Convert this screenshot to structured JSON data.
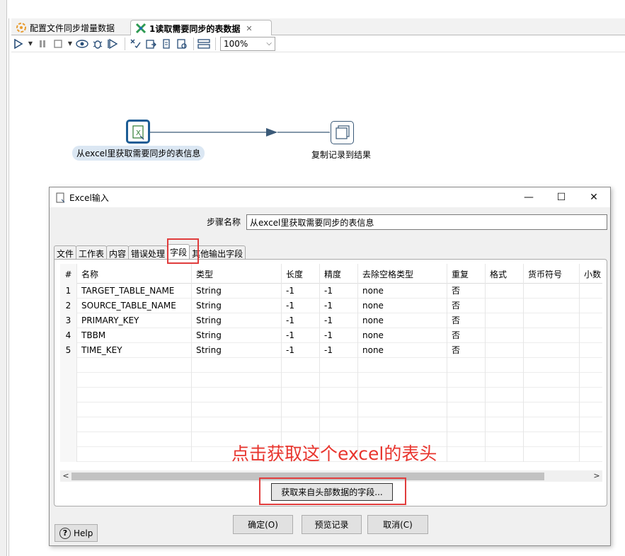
{
  "editor_tabs": [
    {
      "label": "配置文件同步增量数据",
      "icon": "transformation-icon",
      "active": false
    },
    {
      "label": "1读取需要同步的表数据",
      "icon": "job-icon",
      "active": true
    }
  ],
  "toolbar": {
    "zoom": "100%",
    "icons": [
      "run-icon",
      "run-dropdown-icon",
      "pause-icon",
      "stop-icon",
      "stop-dropdown-icon",
      "preview-icon",
      "debug-icon",
      "replay-icon",
      "verify-icon",
      "impact-icon",
      "sql-icon",
      "explore-db-icon",
      "show-results-icon"
    ]
  },
  "canvas": {
    "steps": [
      {
        "label": "从excel里获取需要同步的表信息",
        "icon": "excel-input-icon",
        "selected": true
      },
      {
        "label": "复制记录到结果",
        "icon": "copy-rows-icon",
        "selected": false
      }
    ]
  },
  "dialog": {
    "title": "Excel输入",
    "step_name_label": "步骤名称",
    "step_name_value": "从excel里获取需要同步的表信息",
    "tabs": [
      "文件",
      "工作表",
      "内容",
      "错误处理",
      "字段",
      "其他输出字段"
    ],
    "active_tab": "字段",
    "columns": [
      "#",
      "名称",
      "类型",
      "长度",
      "精度",
      "去除空格类型",
      "重复",
      "格式",
      "货币符号",
      "小数"
    ],
    "rows": [
      [
        "1",
        "TARGET_TABLE_NAME",
        "String",
        "-1",
        "-1",
        "none",
        "否",
        "",
        "",
        ""
      ],
      [
        "2",
        "SOURCE_TABLE_NAME",
        "String",
        "-1",
        "-1",
        "none",
        "否",
        "",
        "",
        ""
      ],
      [
        "3",
        "PRIMARY_KEY",
        "String",
        "-1",
        "-1",
        "none",
        "否",
        "",
        "",
        ""
      ],
      [
        "4",
        "TBBM",
        "String",
        "-1",
        "-1",
        "none",
        "否",
        "",
        "",
        ""
      ],
      [
        "5",
        "TIME_KEY",
        "String",
        "-1",
        "-1",
        "none",
        "否",
        "",
        "",
        ""
      ]
    ],
    "get_fields_button": "获取来自头部数据的字段...",
    "ok_button": "确定(O)",
    "preview_button": "预览记录",
    "cancel_button": "取消(C)",
    "help_button": "Help"
  },
  "annotation": "点击获取这个excel的表头",
  "colors": {
    "accent_red": "#e8352e",
    "step_border": "#2a5d8f"
  }
}
